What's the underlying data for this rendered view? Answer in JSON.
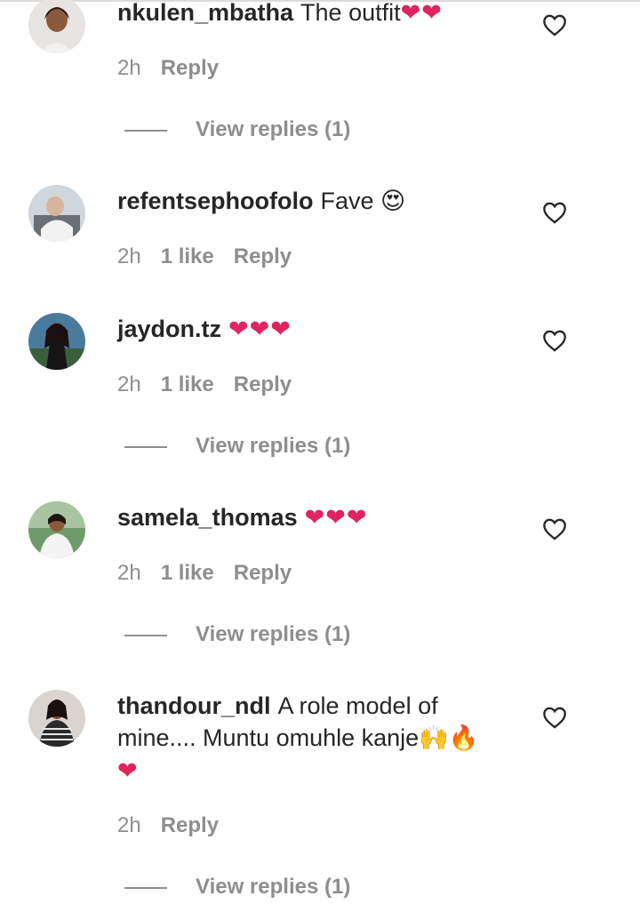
{
  "comments": [
    {
      "username": "nkulen_mbatha",
      "text": "The outfit",
      "emojis": "❤❤",
      "time": "2h",
      "likes": "",
      "reply": "Reply",
      "view_replies": "View replies (1)"
    },
    {
      "username": "refentsephoofolo",
      "text": "Fave",
      "emojis": "😍",
      "time": "2h",
      "likes": "1 like",
      "reply": "Reply",
      "view_replies": ""
    },
    {
      "username": "jaydon.tz",
      "text": "",
      "emojis": "❤❤❤",
      "time": "2h",
      "likes": "1 like",
      "reply": "Reply",
      "view_replies": "View replies (1)"
    },
    {
      "username": "samela_thomas",
      "text": "",
      "emojis": "❤❤❤",
      "time": "2h",
      "likes": "1 like",
      "reply": "Reply",
      "view_replies": "View replies (1)"
    },
    {
      "username": "thandour_ndl",
      "text": "A role model of mine.... Muntu omuhle kanje",
      "emojis": "🙌🔥",
      "emojis_line2": "❤",
      "time": "2h",
      "likes": "",
      "reply": "Reply",
      "view_replies": "View replies (1)"
    }
  ],
  "icons": {
    "like": "heart-outline-icon"
  },
  "colors": {
    "text": "#262626",
    "muted": "#8e8e8e",
    "heart": "#e0245e"
  }
}
